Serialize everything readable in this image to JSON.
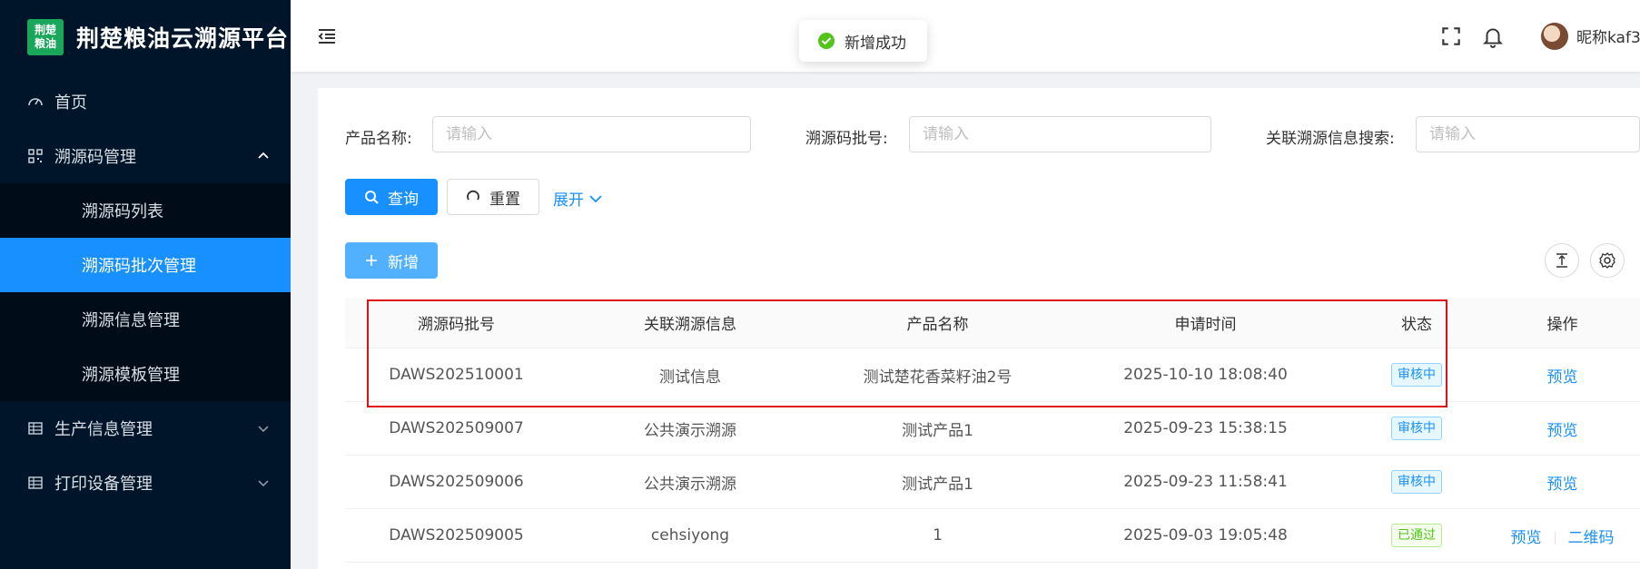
{
  "brand": {
    "logo_line1": "荆楚",
    "logo_line2": "粮油",
    "title": "荆楚粮油云溯源平台"
  },
  "sidebar": {
    "items": [
      {
        "label": "首页",
        "icon": "dashboard-icon"
      },
      {
        "label": "溯源码管理",
        "icon": "qrcode-icon",
        "expanded": true,
        "children": [
          {
            "label": "溯源码列表"
          },
          {
            "label": "溯源码批次管理",
            "active": true
          },
          {
            "label": "溯源信息管理"
          },
          {
            "label": "溯源模板管理"
          }
        ]
      },
      {
        "label": "生产信息管理",
        "icon": "table-icon"
      },
      {
        "label": "打印设备管理",
        "icon": "table-icon"
      }
    ]
  },
  "header": {
    "nickname": "昵称kaf3"
  },
  "toast": {
    "message": "新增成功"
  },
  "search": {
    "product_name_label": "产品名称:",
    "batch_no_label": "溯源码批号:",
    "related_info_label": "关联溯源信息搜索:",
    "placeholder": "请输入",
    "query_label": "查询",
    "reset_label": "重置",
    "expand_label": "展开"
  },
  "toolbar": {
    "add_label": "新增"
  },
  "table": {
    "columns": [
      "溯源码批号",
      "关联溯源信息",
      "产品名称",
      "申请时间",
      "状态",
      "操作"
    ],
    "rows": [
      {
        "batch": "DAWS202510001",
        "related": "测试信息",
        "product": "测试楚花香菜籽油2号",
        "time": "2025-10-10 18:08:40",
        "status": "审核中",
        "status_color": "#1890ff",
        "ops": [
          "预览"
        ]
      },
      {
        "batch": "DAWS202509007",
        "related": "公共演示溯源",
        "product": "测试产品1",
        "time": "2025-09-23 15:38:15",
        "status": "审核中",
        "status_color": "#1890ff",
        "ops": [
          "预览"
        ]
      },
      {
        "batch": "DAWS202509006",
        "related": "公共演示溯源",
        "product": "测试产品1",
        "time": "2025-09-23 11:58:41",
        "status": "审核中",
        "status_color": "#1890ff",
        "ops": [
          "预览"
        ]
      },
      {
        "batch": "DAWS202509005",
        "related": "cehsiyong",
        "product": "1",
        "time": "2025-09-03 19:05:48",
        "status": "已通过",
        "status_color": "#52c41a",
        "ops": [
          "预览",
          "二维码"
        ]
      }
    ]
  }
}
